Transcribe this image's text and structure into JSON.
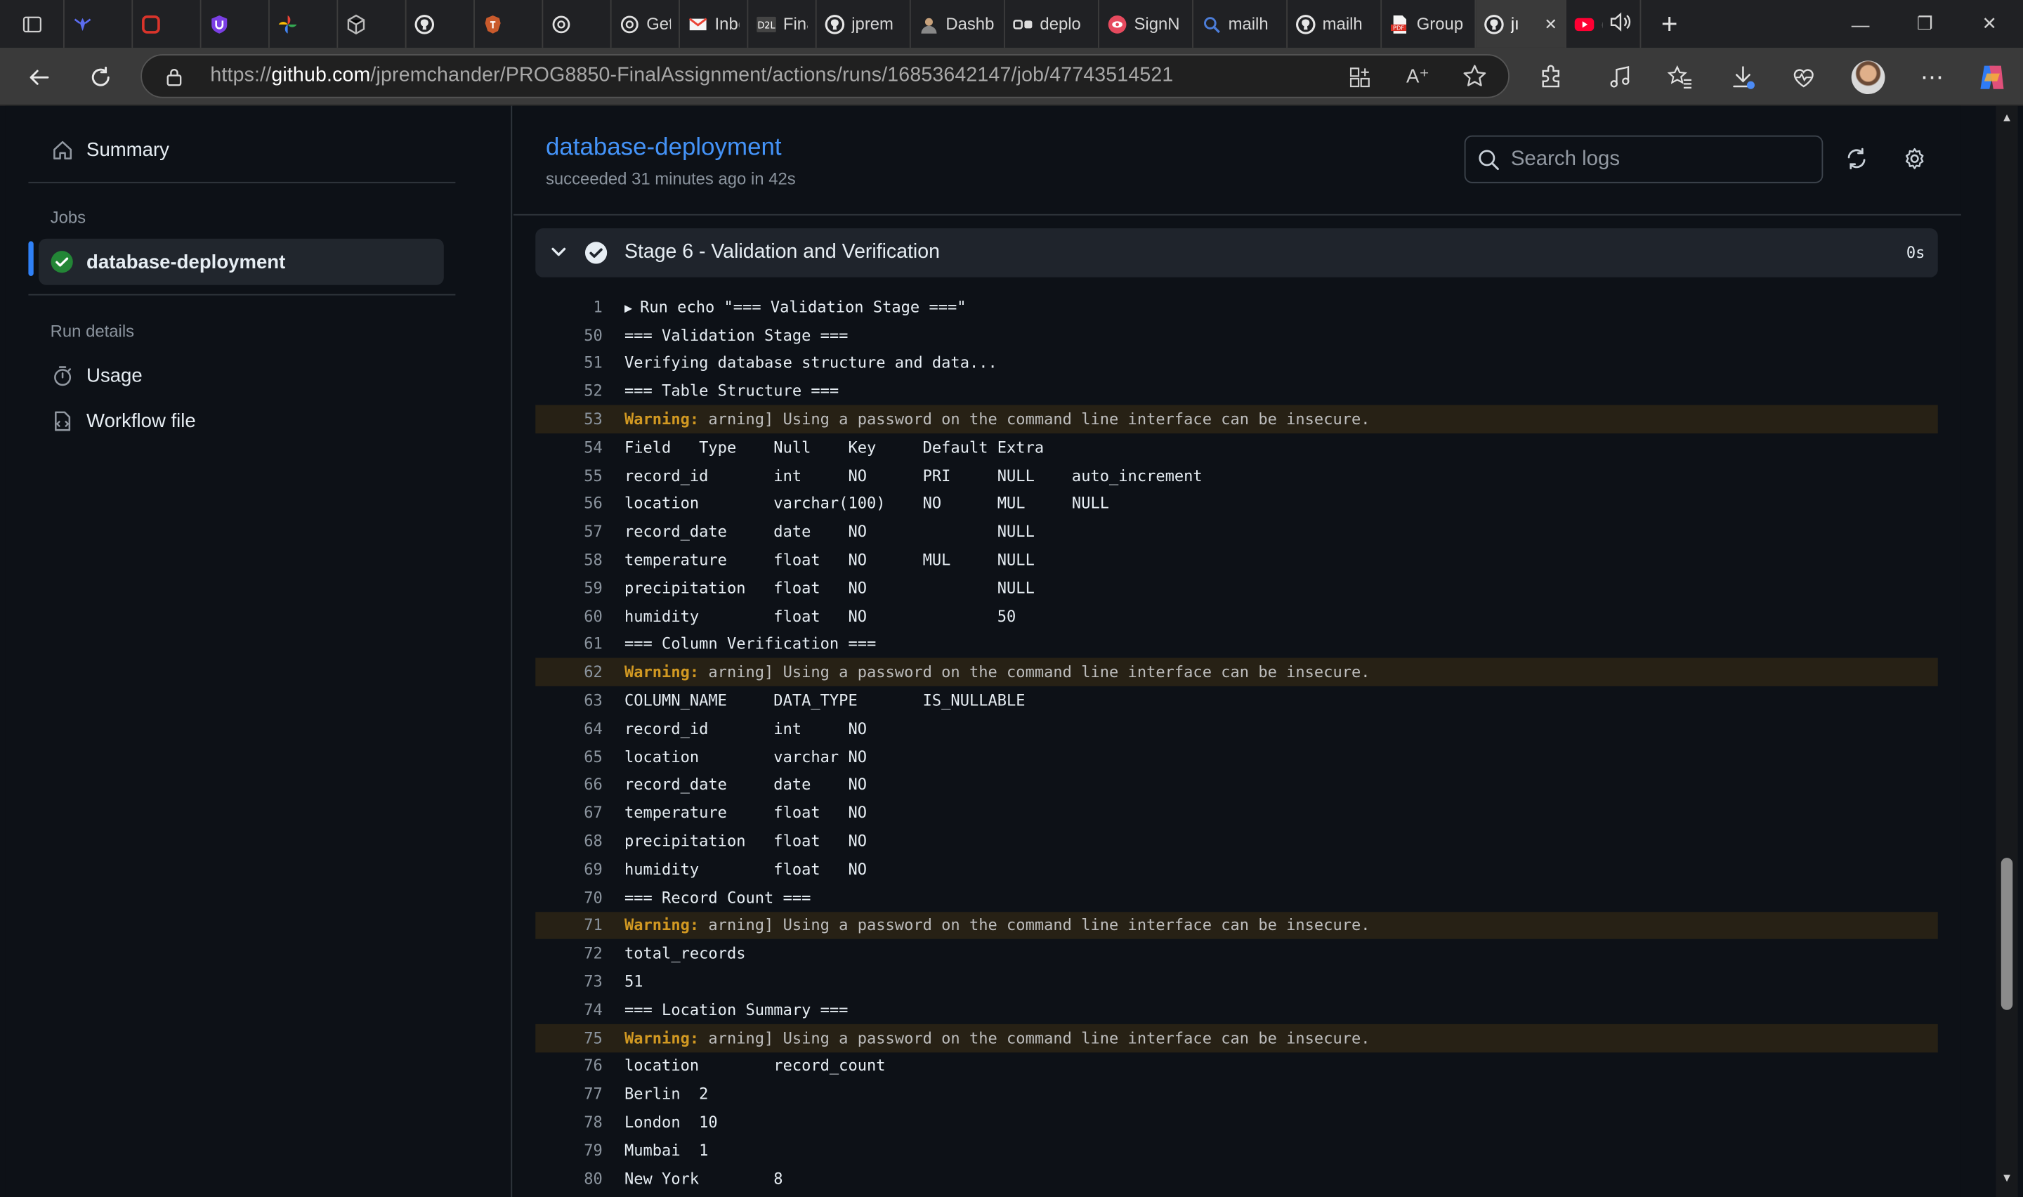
{
  "browser": {
    "tabs": [
      {
        "label": "",
        "icon": "tab-actions-icon"
      },
      {
        "label": "",
        "icon": "spider-icon"
      },
      {
        "label": "",
        "icon": "red-square-icon"
      },
      {
        "label": "",
        "icon": "shield-u-icon"
      },
      {
        "label": "",
        "icon": "pinwheel-icon"
      },
      {
        "label": "",
        "icon": "cube-icon"
      },
      {
        "label": "",
        "icon": "github-icon"
      },
      {
        "label": "",
        "icon": "brave-icon"
      },
      {
        "label": "",
        "icon": "openai-icon"
      },
      {
        "label": "Get S",
        "icon": "openai-icon"
      },
      {
        "label": "Inbox",
        "icon": "gmail-icon"
      },
      {
        "label": "Final (",
        "icon": "d2l-icon"
      },
      {
        "label": "jprem",
        "icon": "github-icon"
      },
      {
        "label": "Dashb",
        "icon": "avatar-icon"
      },
      {
        "label": "deplo",
        "icon": "link-icon"
      },
      {
        "label": "SignN",
        "icon": "eye-icon"
      },
      {
        "label": "mailh",
        "icon": "search-icon"
      },
      {
        "label": "mailh",
        "icon": "github-icon"
      },
      {
        "label": "Group",
        "icon": "pdf-icon"
      },
      {
        "label": "jı",
        "icon": "github-icon",
        "active": true
      },
      {
        "label": "(",
        "icon": "youtube-icon"
      }
    ],
    "url_prefix": "https://",
    "url_host": "github.com",
    "url_path": "/jpremchander/PROG8850-FinalAssignment/actions/runs/16853642147/job/47743514521"
  },
  "sidebar": {
    "summary_label": "Summary",
    "jobs_heading": "Jobs",
    "job_label": "database-deployment",
    "run_details_heading": "Run details",
    "usage_label": "Usage",
    "workflow_label": "Workflow file"
  },
  "job": {
    "title": "database-deployment",
    "status": "succeeded 31 minutes ago in 42s",
    "search_placeholder": "Search logs"
  },
  "stage": {
    "title": "Stage 6 - Validation and Verification",
    "duration": "0s"
  },
  "log": [
    {
      "n": "1",
      "text": "Run echo \"=== Validation Stage ===\"",
      "expand": true
    },
    {
      "n": "50",
      "text": "=== Validation Stage ==="
    },
    {
      "n": "51",
      "text": "Verifying database structure and data..."
    },
    {
      "n": "52",
      "text": "=== Table Structure ==="
    },
    {
      "n": "53",
      "warn": "Warning:",
      "text": " arning] Using a password on the command line interface can be insecure."
    },
    {
      "n": "54",
      "text": "Field   Type    Null    Key     Default Extra"
    },
    {
      "n": "55",
      "text": "record_id       int     NO      PRI     NULL    auto_increment"
    },
    {
      "n": "56",
      "text": "location        varchar(100)    NO      MUL     NULL"
    },
    {
      "n": "57",
      "text": "record_date     date    NO              NULL"
    },
    {
      "n": "58",
      "text": "temperature     float   NO      MUL     NULL"
    },
    {
      "n": "59",
      "text": "precipitation   float   NO              NULL"
    },
    {
      "n": "60",
      "text": "humidity        float   NO              50"
    },
    {
      "n": "61",
      "text": "=== Column Verification ==="
    },
    {
      "n": "62",
      "warn": "Warning:",
      "text": " arning] Using a password on the command line interface can be insecure."
    },
    {
      "n": "63",
      "text": "COLUMN_NAME     DATA_TYPE       IS_NULLABLE"
    },
    {
      "n": "64",
      "text": "record_id       int     NO"
    },
    {
      "n": "65",
      "text": "location        varchar NO"
    },
    {
      "n": "66",
      "text": "record_date     date    NO"
    },
    {
      "n": "67",
      "text": "temperature     float   NO"
    },
    {
      "n": "68",
      "text": "precipitation   float   NO"
    },
    {
      "n": "69",
      "text": "humidity        float   NO"
    },
    {
      "n": "70",
      "text": "=== Record Count ==="
    },
    {
      "n": "71",
      "warn": "Warning:",
      "text": " arning] Using a password on the command line interface can be insecure."
    },
    {
      "n": "72",
      "text": "total_records"
    },
    {
      "n": "73",
      "text": "51"
    },
    {
      "n": "74",
      "text": "=== Location Summary ==="
    },
    {
      "n": "75",
      "warn": "Warning:",
      "text": " arning] Using a password on the command line interface can be insecure."
    },
    {
      "n": "76",
      "text": "location        record_count"
    },
    {
      "n": "77",
      "text": "Berlin  2"
    },
    {
      "n": "78",
      "text": "London  10"
    },
    {
      "n": "79",
      "text": "Mumbai  1"
    },
    {
      "n": "80",
      "text": "New York        8"
    }
  ],
  "colors": {
    "link": "#4493f8",
    "success": "#238636",
    "warning": "#d29922",
    "bg": "#0d1117",
    "accent": "#2f81f7"
  }
}
